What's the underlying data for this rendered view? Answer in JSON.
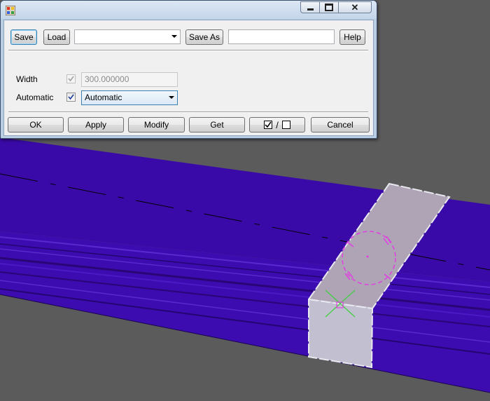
{
  "dialog": {
    "title": "",
    "toolbar": {
      "save_label": "Save",
      "load_label": "Load",
      "preset_value": "",
      "save_as_label": "Save As",
      "save_as_value": "",
      "help_label": "Help"
    },
    "form": {
      "width_label": "Width",
      "width_checked": true,
      "width_value": "300.000000",
      "automatic_label": "Automatic",
      "automatic_checked": true,
      "automatic_value": "Automatic"
    },
    "buttons": {
      "ok": "OK",
      "apply": "Apply",
      "modify": "Modify",
      "get": "Get",
      "toggle_separator": "/",
      "cancel": "Cancel"
    }
  },
  "colors": {
    "beam": "#3a0aa8",
    "beam_dark": "#2a0575",
    "plate": "#b8b0c4",
    "background": "#5b5b5b",
    "handle": "#e040e0",
    "marker": "#40d040"
  }
}
